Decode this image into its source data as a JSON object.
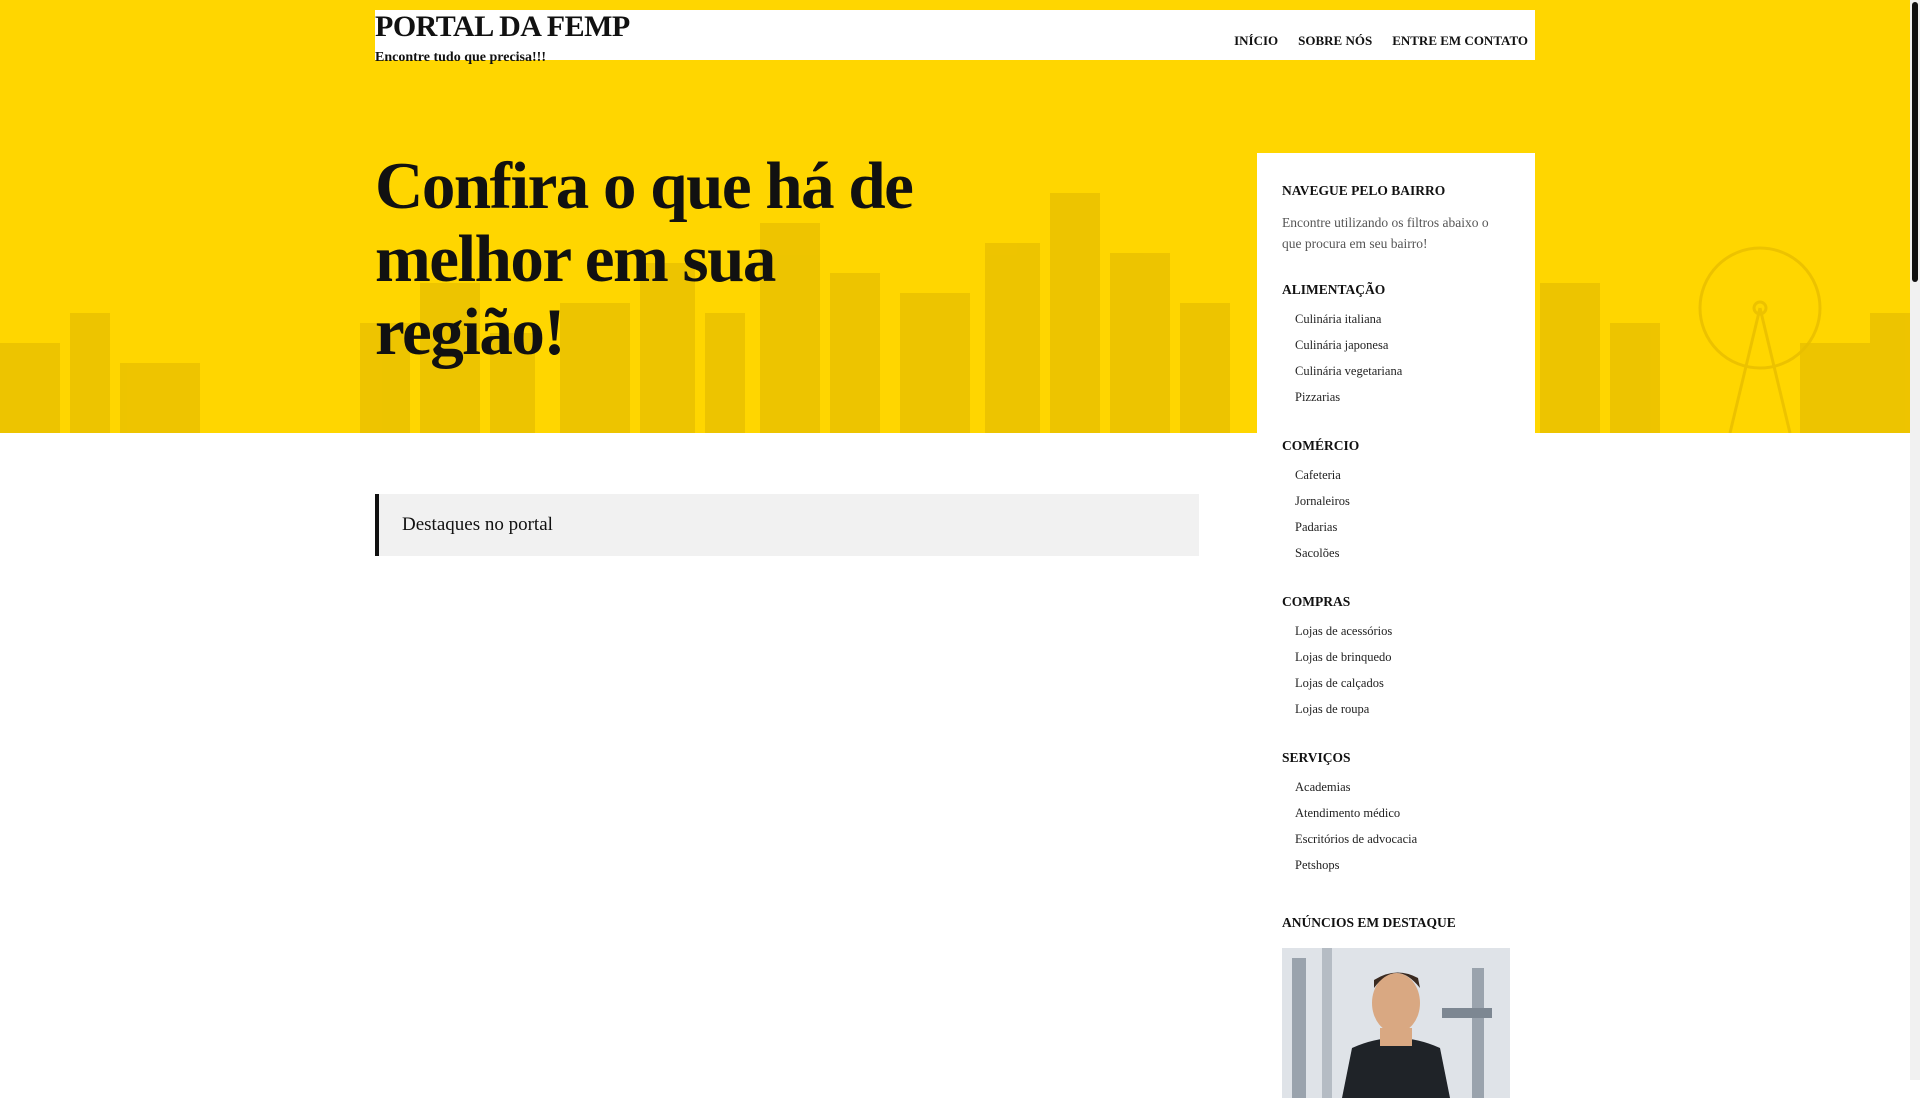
{
  "header": {
    "site_title": "PORTAL DA FEMP",
    "tagline": "Encontre tudo que precisa!!!",
    "nav": [
      "INÍCIO",
      "SOBRE NÓS",
      "ENTRE EM CONTATO"
    ]
  },
  "hero": {
    "headline": "Confira o que há de melhor em sua região!"
  },
  "main": {
    "section_title": "Destaques no portal"
  },
  "sidebar": {
    "title": "NAVEGUE PELO BAIRRO",
    "description": "Encontre utilizando os filtros abaixo o que procura em seu bairro!",
    "categories": [
      {
        "title": "ALIMENTAÇÃO",
        "items": [
          "Culinária italiana",
          "Culinária japonesa",
          "Culinária vegetariana",
          "Pizzarias"
        ]
      },
      {
        "title": "COMÉRCIO",
        "items": [
          "Cafeteria",
          "Jornaleiros",
          "Padarias",
          "Sacolões"
        ]
      },
      {
        "title": "COMPRAS",
        "items": [
          "Lojas de acessórios",
          "Lojas de brinquedo",
          "Lojas de calçados",
          "Lojas de roupa"
        ]
      },
      {
        "title": "SERVIÇOS",
        "items": [
          "Academias",
          "Atendimento médico",
          "Escritórios de advocacia",
          "Petshops"
        ]
      }
    ],
    "ads_title": "ANÚNCIOS EM DESTAQUE"
  },
  "colors": {
    "accent": "#FFD600",
    "text": "#111111",
    "panel": "#f1f1f1"
  }
}
